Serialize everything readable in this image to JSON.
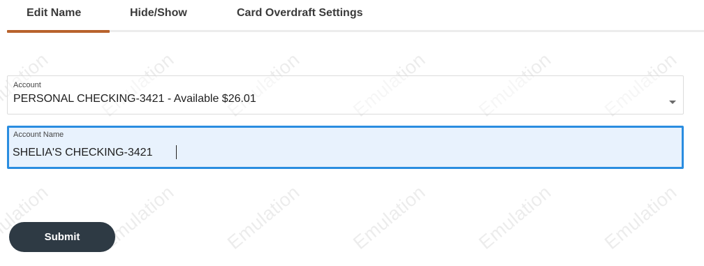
{
  "tabs": [
    {
      "label": "Edit Name",
      "active": true
    },
    {
      "label": "Hide/Show",
      "active": false
    },
    {
      "label": "Card Overdraft Settings",
      "active": false
    }
  ],
  "account_select": {
    "label": "Account",
    "value": "PERSONAL CHECKING-3421 - Available $26.01"
  },
  "account_name": {
    "label": "Account Name",
    "value": "SHELIA'S CHECKING-3421"
  },
  "submit_label": "Submit",
  "watermark_text": "Emulation",
  "colors": {
    "active_tab_accent": "#b8622c",
    "focus_border": "#2a8de0",
    "focus_fill": "#e8f2fd",
    "button_bg": "#2e3a44"
  }
}
